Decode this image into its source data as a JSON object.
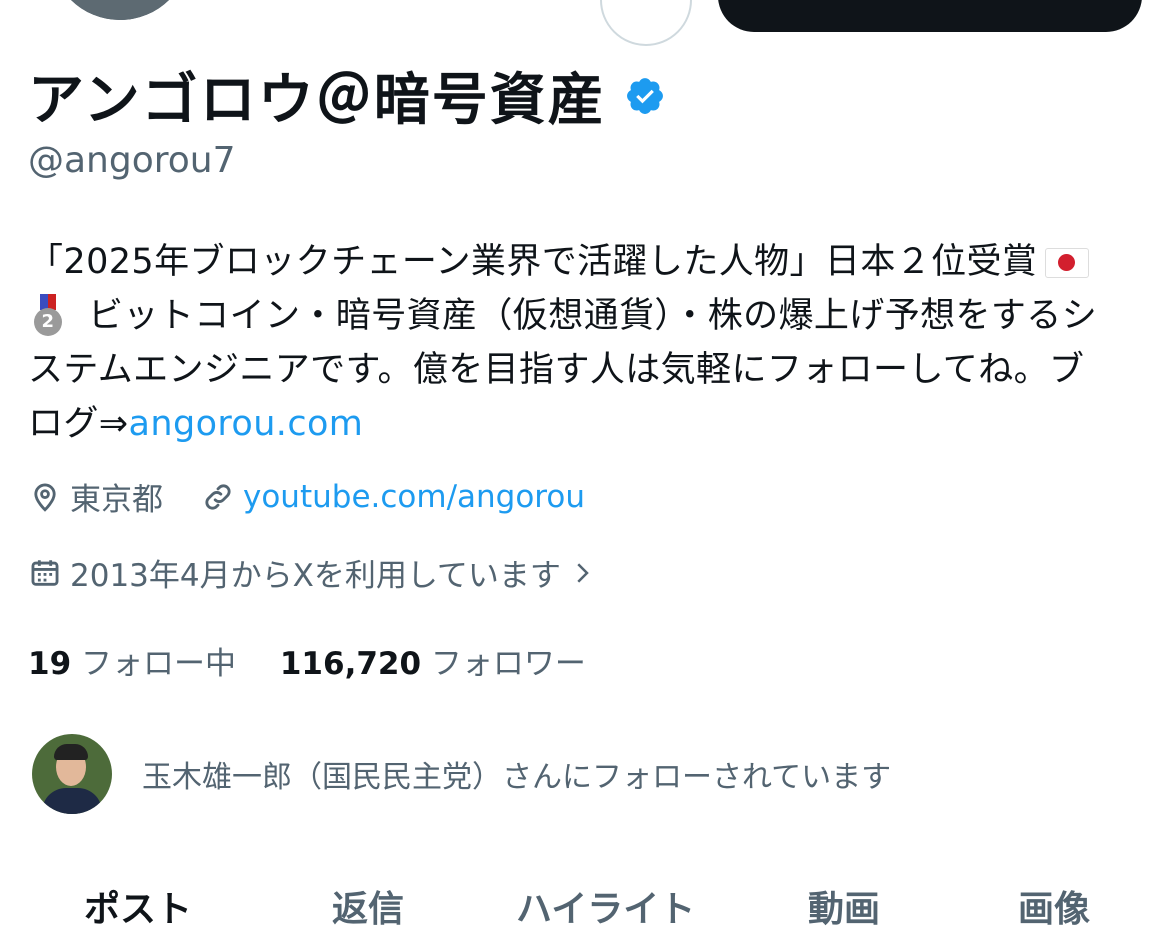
{
  "profile": {
    "display_name": "アンゴロウ＠暗号資産",
    "handle": "@angorou7",
    "verified": true,
    "bio": {
      "line1": "「2025年ブロックチェーン業界で活躍した人物」日本２位受賞",
      "line2": "ビットコイン・暗号資産（仮想通貨）・株の爆上げ予想をするシ",
      "line3": "ステムエンジニアです。億を目指す人は気軽にフォローしてね。ブ",
      "line4_prefix": "ログ⇒",
      "link": "angorou.com"
    },
    "location": "東京都",
    "website": "youtube.com/angorou",
    "joined": "2013年4月からXを利用しています"
  },
  "stats": {
    "following_count": "19",
    "following_label": "フォロー中",
    "followers_count": "116,720",
    "followers_label": "フォロワー"
  },
  "followed_by": {
    "text": "玉木雄一郎（国民民主党）さんにフォローされています"
  },
  "tabs": [
    {
      "label": "ポスト",
      "active": true
    },
    {
      "label": "返信",
      "active": false
    },
    {
      "label": "ハイライト",
      "active": false
    },
    {
      "label": "動画",
      "active": false
    },
    {
      "label": "画像",
      "active": false
    }
  ],
  "icons": {
    "verified": "verified-badge-icon",
    "location": "location-pin-icon",
    "link": "link-icon",
    "calendar": "calendar-icon",
    "chevron": "chevron-right-icon",
    "flag": "japan-flag-icon",
    "medal": "second-place-medal-icon"
  },
  "colors": {
    "text": "#0f1419",
    "secondary": "#536471",
    "link": "#1d9bf0",
    "verified": "#1d9bf0"
  }
}
